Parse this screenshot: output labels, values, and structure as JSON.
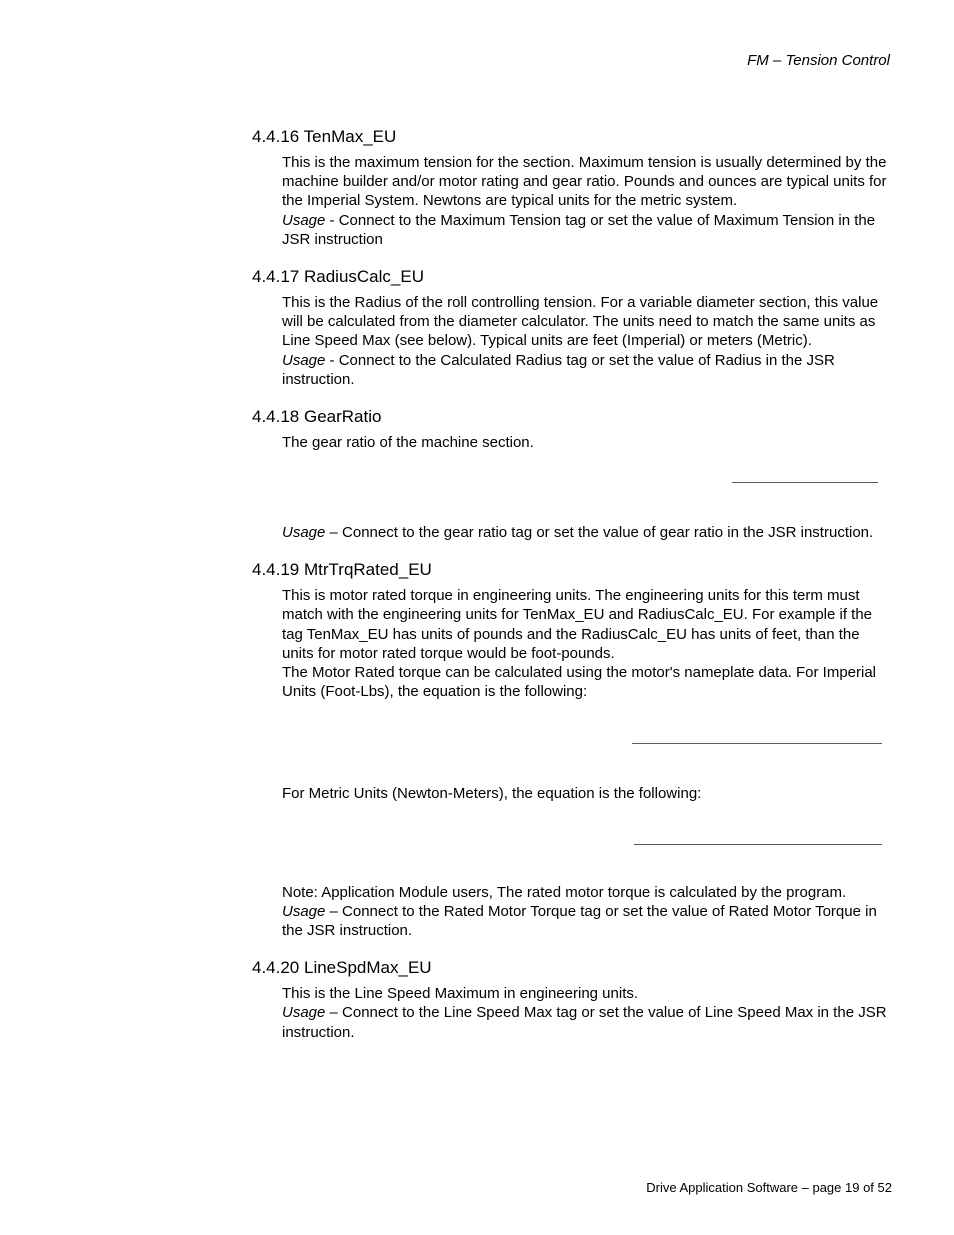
{
  "header": {
    "title": "FM – Tension Control"
  },
  "sections": {
    "s1": {
      "heading": "4.4.16 TenMax_EU",
      "body": "This is the maximum tension for the section.  Maximum tension is usually determined by the machine builder and/or motor rating and gear ratio.  Pounds and ounces are typical units for the Imperial System.  Newtons are typical units for the metric system.",
      "usage_label": "Usage",
      "usage_text": " - Connect to the Maximum Tension tag or set the value of Maximum Tension in the JSR instruction"
    },
    "s2": {
      "heading": "4.4.17 RadiusCalc_EU",
      "body": "This is the Radius of the roll controlling tension.  For a variable diameter section, this value will be calculated from the diameter calculator.  The units need to match the same units as Line Speed Max (see below).  Typical units are feet (Imperial) or meters (Metric).",
      "usage_label": "Usage",
      "usage_text": " - Connect to the Calculated Radius tag or set the value of Radius in the JSR instruction."
    },
    "s3": {
      "heading": "4.4.18 GearRatio",
      "body": "The gear ratio of the machine section.",
      "usage_label": "Usage",
      "usage_text": " – Connect to the gear ratio tag or set the value of gear ratio in the JSR instruction."
    },
    "s4": {
      "heading": "4.4.19 MtrTrqRated_EU",
      "body1": "This is motor rated torque in engineering units.  The engineering units for this term must match with the engineering units for TenMax_EU and RadiusCalc_EU.  For example if the tag TenMax_EU has units of pounds and the RadiusCalc_EU has units of feet, than the units for motor rated torque would be foot-pounds.",
      "body2": "The Motor Rated torque can be calculated using the motor's nameplate data.  For Imperial Units (Foot-Lbs), the equation is the following:",
      "body3": "For Metric Units (Newton-Meters), the equation is the following:",
      "note": "Note: Application Module users, The rated motor torque is calculated by the program.",
      "usage_label": "Usage",
      "usage_text": " – Connect to the Rated Motor Torque tag or set the value of Rated Motor Torque in the JSR instruction."
    },
    "s5": {
      "heading": "4.4.20  LineSpdMax_EU",
      "body": "This is the Line Speed Maximum in engineering units.",
      "usage_label": "Usage",
      "usage_text": " – Connect to the Line Speed Max tag or set the value of Line Speed Max in the JSR instruction."
    }
  },
  "footer": {
    "text": "Drive Application Software – page 19 of 52"
  }
}
